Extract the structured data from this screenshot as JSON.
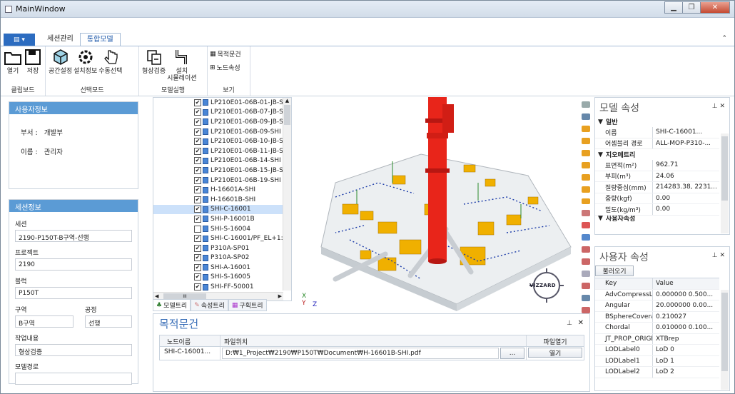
{
  "window": {
    "title": "MainWindow"
  },
  "ribbon": {
    "tabs": [
      "세션관리",
      "통합모델"
    ],
    "groups": [
      {
        "label": "클립보드",
        "buttons": [
          "열기",
          "저장"
        ]
      },
      {
        "label": "선택모드",
        "buttons": [
          "공간설정",
          "설치정보",
          "수동선택"
        ]
      },
      {
        "label": "모델실행",
        "buttons": [
          "형상검증",
          "설치\n시뮬레이션"
        ]
      },
      {
        "label": "보기",
        "buttons": [
          "목적문건",
          "노드속성"
        ]
      }
    ]
  },
  "user_info": {
    "title": "사용자정보",
    "dept_label": "부서 :",
    "dept": "개발부",
    "name_label": "이름 :",
    "name": "관리자"
  },
  "session_info": {
    "title": "세션정보",
    "fields": [
      {
        "label": "세션",
        "value": "2190-P150T-B구역-선행"
      },
      {
        "label": "프로젝트",
        "value": "2190"
      },
      {
        "label": "블럭",
        "value": "P150T"
      }
    ],
    "zone_label": "구역",
    "zone": "B구역",
    "process_label": "공정",
    "process": "선행",
    "work_label": "작업내용",
    "work": "형상검증",
    "model_path_label": "모델경로",
    "model_path": ""
  },
  "tree": {
    "items": [
      {
        "label": "LP210E01-06B-01-JB-S",
        "checked": true
      },
      {
        "label": "LP210E01-06B-07-JB-S",
        "checked": true
      },
      {
        "label": "LP210E01-06B-09-JB-S",
        "checked": true
      },
      {
        "label": "LP210E01-06B-09-SHI",
        "checked": true
      },
      {
        "label": "LP210E01-06B-10-JB-S",
        "checked": true
      },
      {
        "label": "LP210E01-06B-11-JB-S",
        "checked": true
      },
      {
        "label": "LP210E01-06B-14-SHI",
        "checked": true
      },
      {
        "label": "LP210E01-06B-15-JB-S",
        "checked": true
      },
      {
        "label": "LP210E01-06B-19-SHI",
        "checked": true
      },
      {
        "label": "H-16601A-SHI",
        "checked": true
      },
      {
        "label": "H-16601B-SHI",
        "checked": true
      },
      {
        "label": "SHI-C-16001",
        "checked": true,
        "selected": true
      },
      {
        "label": "SHI-P-16001B",
        "checked": true
      },
      {
        "label": "SHI-S-16004",
        "checked": false
      },
      {
        "label": "SHI-C-16001/PF_EL+1:",
        "checked": true
      },
      {
        "label": "P310A-SP01",
        "checked": true
      },
      {
        "label": "P310A-SP02",
        "checked": true
      },
      {
        "label": "SHI-A-16001",
        "checked": true
      },
      {
        "label": "SHI-S-16005",
        "checked": true
      },
      {
        "label": "SHI-FF-50001",
        "checked": true
      }
    ],
    "tabs": [
      "모델트리",
      "속성트리",
      "구획트리"
    ],
    "scroll_indicator": "III"
  },
  "viewport": {
    "badge": "VIZZARD",
    "axis_x": "X",
    "axis_y": "Y",
    "axis_z": "Z"
  },
  "documents": {
    "title": "목적문건",
    "columns": [
      "노드이름",
      "파일위치",
      "파일열기"
    ],
    "rows": [
      {
        "node": "SHI-C-16001...",
        "path": "D:₩1_Project₩2190₩P150T₩Document₩H-16601B-SHI.pdf",
        "browse": "...",
        "open": "열기"
      }
    ]
  },
  "model_props": {
    "title": "모델 속성",
    "categories": [
      {
        "name": "일반",
        "expanded": true,
        "rows": [
          {
            "k": "이름",
            "v": "SHI-C-16001..."
          },
          {
            "k": "어셈블리 경로",
            "v": "ALL-MOP-P310-..."
          }
        ]
      },
      {
        "name": "지오메트리",
        "expanded": true,
        "rows": [
          {
            "k": "표면적(m²)",
            "v": "962.71"
          },
          {
            "k": "부피(m³)",
            "v": "24.06"
          },
          {
            "k": "질량중심(mm)",
            "v": "214283.38, 2231..."
          },
          {
            "k": "중량(kgf)",
            "v": "0.00"
          },
          {
            "k": "밀도(kg/m³)",
            "v": "0.00"
          }
        ]
      }
    ],
    "more": "사용자속성"
  },
  "user_props": {
    "title": "사용자 속성",
    "load_button": "불러오기",
    "columns": [
      "Key",
      "Value"
    ],
    "rows": [
      {
        "k": "AdvCompressL...",
        "v": "0.000000 0.500..."
      },
      {
        "k": "Angular",
        "v": "20.000000 0.00..."
      },
      {
        "k": "BSphereCovera...",
        "v": "0.210027"
      },
      {
        "k": "Chordal",
        "v": "0.010000 0.100..."
      },
      {
        "k": "JT_PROP_ORIGI...",
        "v": "XTBrep"
      },
      {
        "k": "LODLabel0",
        "v": "LoD 0"
      },
      {
        "k": "LODLabel1",
        "v": "LoD 1"
      },
      {
        "k": "LODLabel2",
        "v": "LoD 2"
      }
    ]
  },
  "colors": {
    "accent": "#2c6cc0",
    "panel_header": "#5b9bd5",
    "selection": "#cce1fa",
    "model_red": "#e8251a",
    "model_yellow": "#f0b000"
  }
}
